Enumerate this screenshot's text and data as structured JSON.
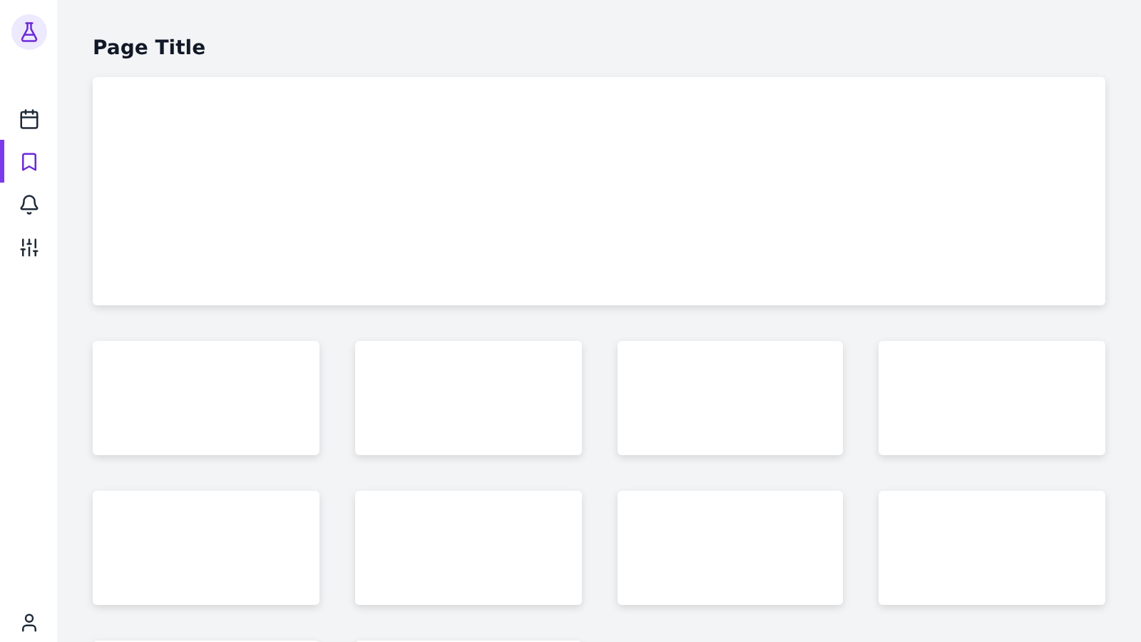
{
  "title": "Page Title",
  "nav": [
    {
      "selected": false
    },
    {
      "selected": true
    },
    {
      "selected": false
    },
    {
      "selected": false
    }
  ]
}
